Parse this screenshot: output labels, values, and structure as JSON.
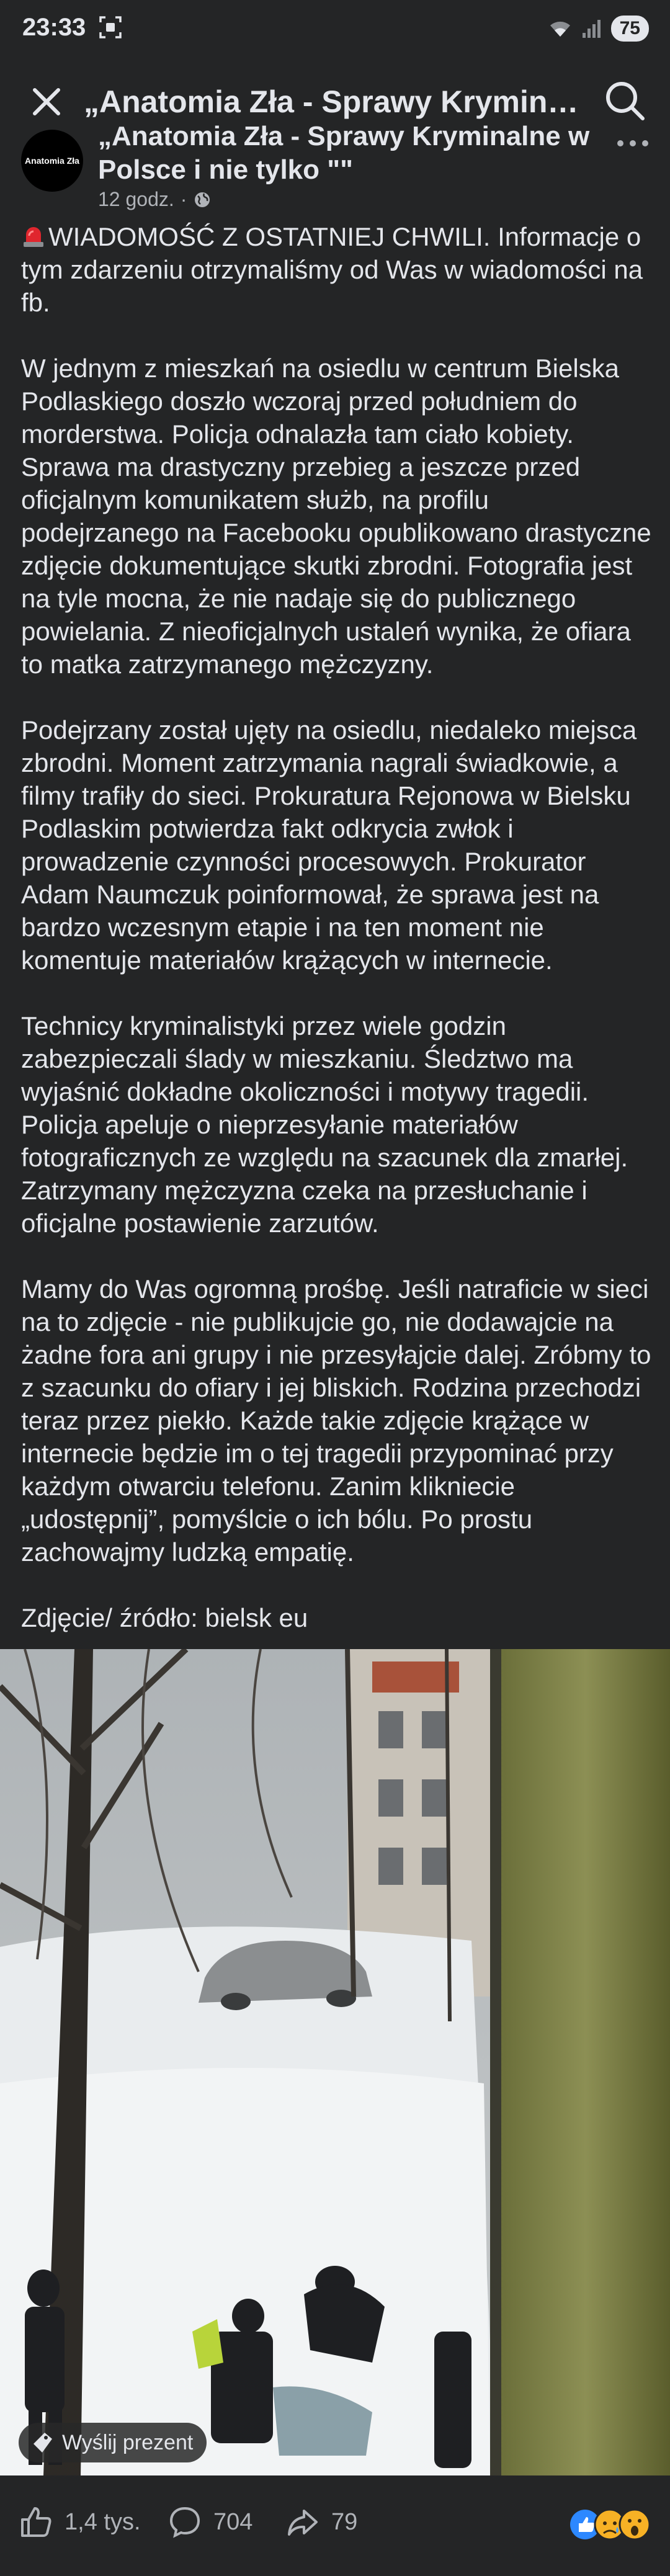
{
  "status": {
    "time": "23:33",
    "battery": "75"
  },
  "header": {
    "title": "„Anatomia Zła - Sprawy Kryminalne w..."
  },
  "post": {
    "page_name": "„Anatomia Zła - Sprawy Kryminalne w Polsce i nie tylko \"\"",
    "avatar_text": "Anatomia Zła",
    "time": "12 godz.",
    "separator": "·",
    "paragraphs": [
      "WIADOMOŚĆ Z OSTATNIEJ CHWILI. Informacje o tym zdarzeniu otrzymaliśmy od Was w wiadomości na fb.",
      "W jednym z mieszkań na osiedlu w centrum Bielska Podlaskiego doszło wczoraj przed południem do morderstwa. Policja odnalazła tam ciało kobiety. Sprawa ma drastyczny przebieg a jeszcze przed oficjalnym komunikatem służb, na profilu podejrzanego na Facebooku opublikowano drastyczne zdjęcie dokumentujące skutki zbrodni. Fotografia jest na tyle mocna, że nie nadaje się do publicznego powielania. Z nieoficjalnych ustaleń wynika, że ofiara to matka zatrzymanego mężczyzny.",
      "Podejrzany został ujęty na osiedlu, niedaleko miejsca zbrodni. Moment zatrzymania nagrali świadkowie, a filmy trafiły do sieci. Prokuratura Rejonowa w Bielsku Podlaskim potwierdza fakt odkrycia zwłok i prowadzenie czynności procesowych. Prokurator Adam Naumczuk poinformował, że sprawa jest na bardzo wczesnym etapie i na ten moment nie komentuje materiałów  krążących w internecie.",
      "Technicy kryminalistyki przez wiele godzin zabezpieczali ślady w mieszkaniu. Śledztwo ma wyjaśnić dokładne okoliczności i motywy tragedii. Policja apeluje o nieprzesyłanie materiałów fotograficznych ze względu na szacunek dla zmarłej. Zatrzymany mężczyzna czeka na przesłuchanie i oficjalne postawienie zarzutów.",
      "Mamy do Was ogromną prośbę. Jeśli natraficie w sieci na to zdjęcie - nie publikujcie go, nie dodawajcie na żadne fora ani grupy i nie przesyłajcie dalej. Zróbmy to z szacunku do ofiary i jej bliskich. Rodzina przechodzi teraz przez piekło. Każde takie zdjęcie krążące w internecie będzie im o tej tragedii przypominać przy każdym otwarciu telefonu. Zanim klikniecie „udostępnij”, pomyślcie o ich bólu. Po prostu zachowajmy ludzką empatię.",
      "Zdjęcie/ źródło: bielsk eu"
    ],
    "gift_label": "Wyślij prezent"
  },
  "actions": {
    "likes": "1,4 tys.",
    "comments": "704",
    "shares": "79"
  },
  "icons": {
    "close": "close-icon",
    "search": "search-icon",
    "more": "more-icon",
    "globe": "globe-icon",
    "like": "like-icon",
    "comment": "comment-icon",
    "share": "share-icon",
    "gift": "gift-icon",
    "red_light": "police-light-icon"
  },
  "colors": {
    "background": "#242526",
    "text": "#e4e6eb",
    "secondary": "#b0b3b8",
    "like_blue": "#2d88ff"
  }
}
